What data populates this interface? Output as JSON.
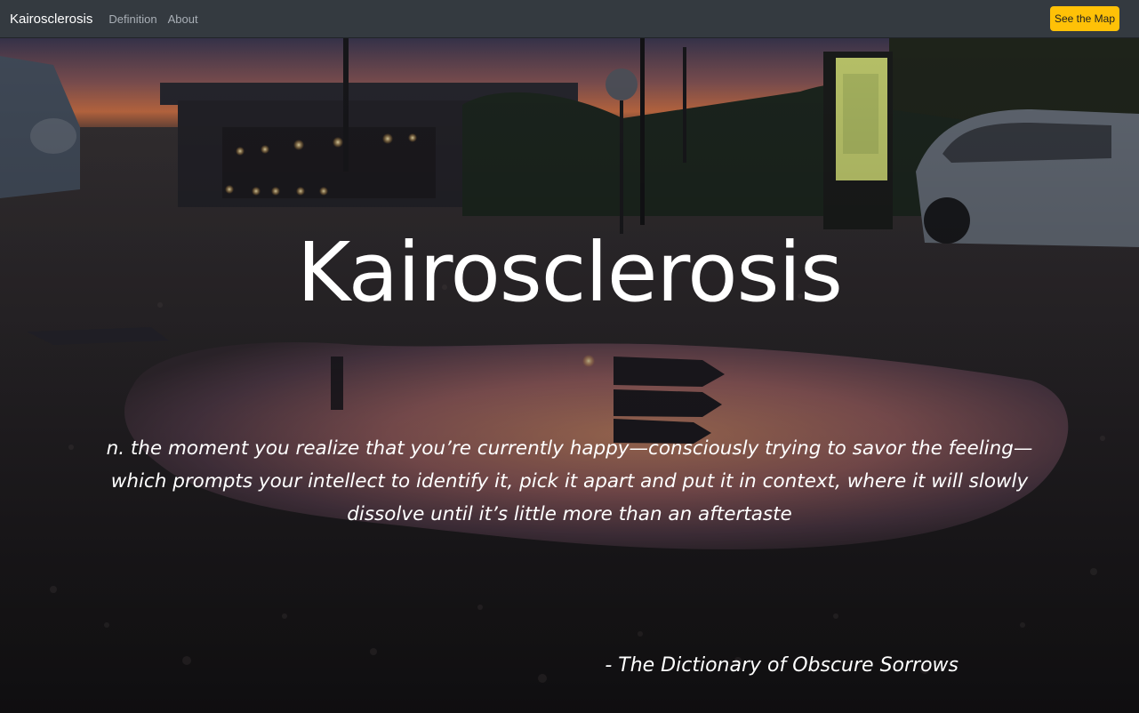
{
  "navbar": {
    "brand": "Kairosclerosis",
    "links": [
      "Definition",
      "About"
    ],
    "map_button": "See the Map"
  },
  "hero": {
    "title": "Kairosclerosis",
    "definition": "n. the moment you realize that you’re currently happy—consciously trying to savor the feeling—which prompts your intellect to identify it, pick it apart and put it in context, where it will slowly dissolve until it’s little more than an aftertaste",
    "attribution": "- The Dictionary of Obscure Sorrows"
  },
  "colors": {
    "navbar_bg": "#343a40",
    "accent": "#ffc107",
    "text": "#ffffff"
  }
}
